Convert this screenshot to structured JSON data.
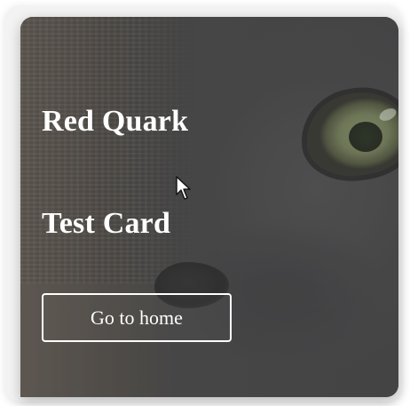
{
  "card": {
    "title": "Red Quark",
    "subtitle": "Test Card",
    "button_label": "Go to home"
  },
  "icons": {
    "cursor": "mouse-pointer-icon"
  },
  "colors": {
    "text": "#ffffff",
    "button_border": "#ffffff",
    "card_overlay": "#4b4b4b"
  }
}
